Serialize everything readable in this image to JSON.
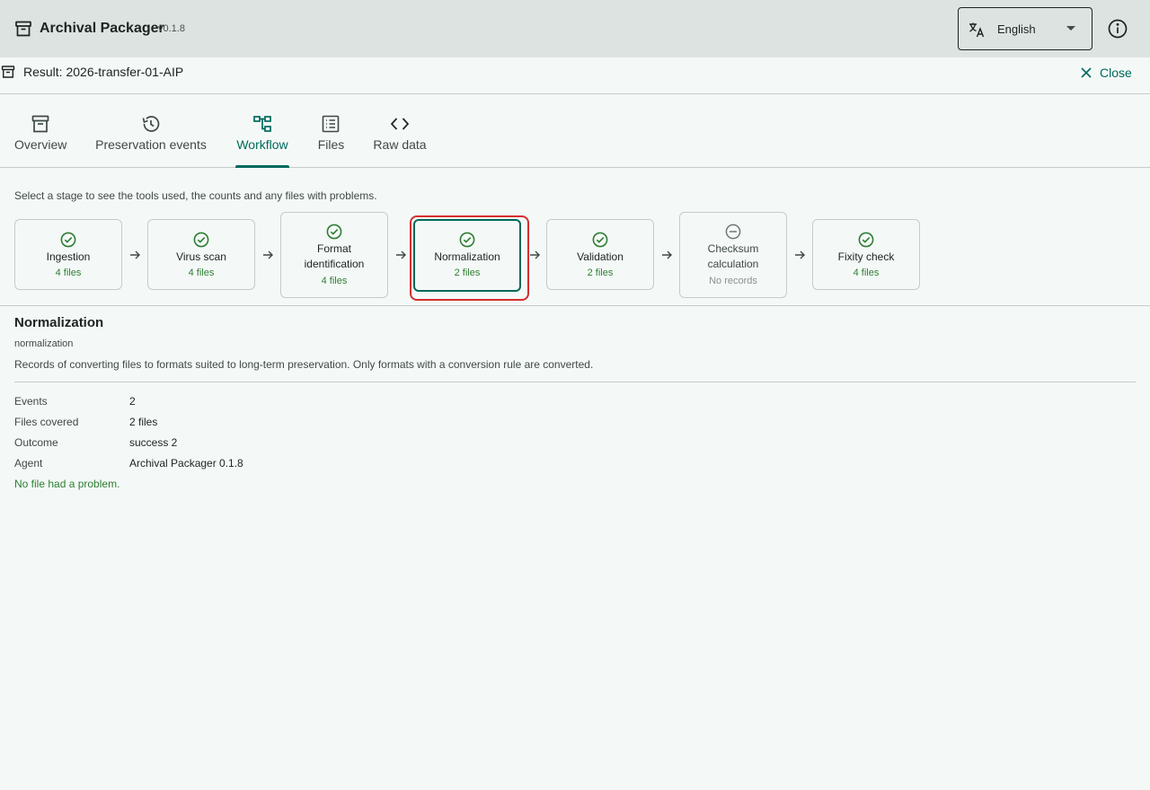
{
  "app": {
    "title": "Archival Packager",
    "version": "v0.1.8"
  },
  "language": {
    "selected": "English"
  },
  "result": {
    "title": "Result: 2026-transfer-01-AIP",
    "close_label": "Close"
  },
  "tabs": [
    {
      "label": "Overview",
      "icon": "archive-box-icon"
    },
    {
      "label": "Preservation events",
      "icon": "history-icon"
    },
    {
      "label": "Workflow",
      "icon": "workflow-icon",
      "active": true
    },
    {
      "label": "Files",
      "icon": "list-icon"
    },
    {
      "label": "Raw data",
      "icon": "code-icon"
    }
  ],
  "workflow": {
    "hint": "Select a stage to see the tools used, the counts and any files with problems.",
    "stages": [
      {
        "name": "Ingestion",
        "count": "4 files",
        "status": "success"
      },
      {
        "name": "Virus scan",
        "count": "4 files",
        "status": "success"
      },
      {
        "name_line1": "Format",
        "name_line2": "identification",
        "count": "4 files",
        "status": "success"
      },
      {
        "name": "Normalization",
        "count": "2 files",
        "status": "success",
        "selected": true
      },
      {
        "name": "Validation",
        "count": "2 files",
        "status": "success"
      },
      {
        "name_line1": "Checksum",
        "name_line2": "calculation",
        "count": "No records",
        "status": "none"
      },
      {
        "name": "Fixity check",
        "count": "4 files",
        "status": "success"
      }
    ]
  },
  "detail": {
    "title": "Normalization",
    "code": "normalization",
    "description": "Records of converting files to formats suited to long-term preservation. Only formats with a conversion rule are converted.",
    "fields": [
      {
        "label": "Events",
        "value": "2"
      },
      {
        "label": "Files covered",
        "value": "2 files"
      },
      {
        "label": "Outcome",
        "value": "success 2"
      },
      {
        "label": "Agent",
        "value": "Archival Packager 0.1.8"
      }
    ],
    "ok_note": "No file had a problem."
  },
  "colors": {
    "accent": "#00695c",
    "success": "#2e7d32",
    "highlight": "#d32f2f",
    "appbar": "#dde3e1",
    "background": "#f4f9f7"
  }
}
